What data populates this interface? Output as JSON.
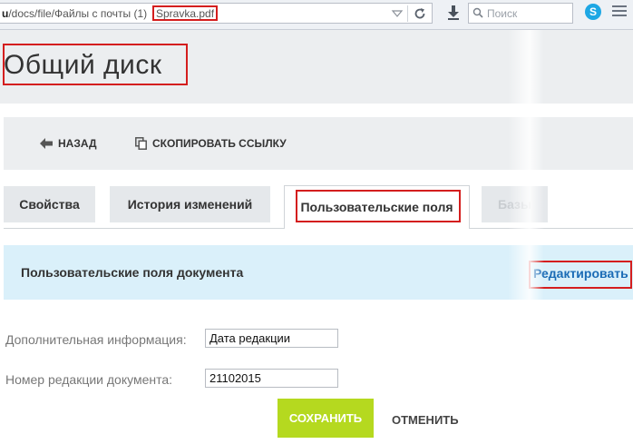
{
  "browser": {
    "url_prefix_bold": "u",
    "url_path": "/docs/file/Файлы с почты (1)",
    "url_file": "Spravka.pdf",
    "search_placeholder": "Поиск"
  },
  "page": {
    "title": "Общий диск"
  },
  "toolbar": {
    "back_label": "НАЗАД",
    "copy_link_label": "СКОПИРОВАТЬ ССЫЛКУ"
  },
  "tabs": [
    {
      "label": "Свойства"
    },
    {
      "label": "История изменений"
    },
    {
      "label": "Пользовательские поля",
      "active": true
    },
    {
      "label": "Базы"
    }
  ],
  "section": {
    "title": "Пользовательские поля документа",
    "edit_link": "Редактировать"
  },
  "form": {
    "fields": [
      {
        "label": "Дополнительная информация:",
        "value": "Дата редакции"
      },
      {
        "label": "Номер редакции документа:",
        "value": "21102015"
      }
    ],
    "save_label": "СОХРАНИТЬ",
    "cancel_label": "ОТМЕНИТЬ"
  },
  "colors": {
    "accent_green": "#b5d91f",
    "banner_blue": "#daf0fa",
    "link_blue": "#1a6bb5",
    "highlight_red": "#d41e1e"
  }
}
